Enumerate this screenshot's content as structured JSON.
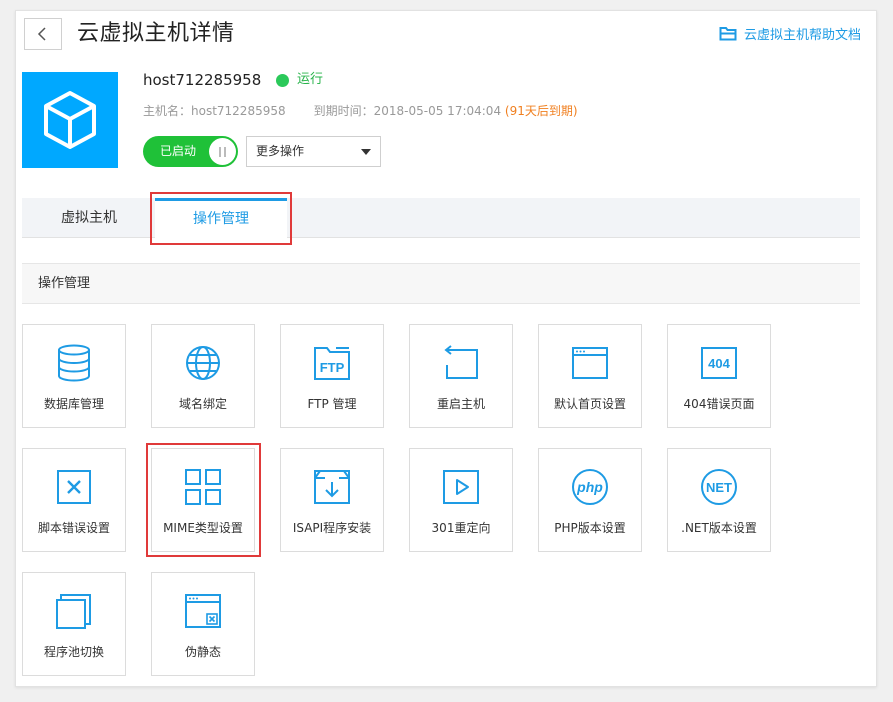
{
  "header": {
    "title": "云虚拟主机详情",
    "help_link": "云虚拟主机帮助文档"
  },
  "host": {
    "name": "host712285958",
    "status": "运行",
    "hostname_label": "主机名：host712285958",
    "expiry_label": "到期时间：2018-05-05 17:04:04",
    "expiry_note": "(91天后到期)",
    "toggle_label": "已启动",
    "more_actions": "更多操作"
  },
  "tabs": [
    {
      "label": "虚拟主机"
    },
    {
      "label": "操作管理"
    }
  ],
  "section": {
    "title": "操作管理"
  },
  "tiles": [
    {
      "label": "数据库管理",
      "icon": "database-icon"
    },
    {
      "label": "域名绑定",
      "icon": "globe-icon"
    },
    {
      "label": "FTP 管理",
      "icon": "ftp-folder-icon",
      "icon_text": "FTP"
    },
    {
      "label": "重启主机",
      "icon": "restart-icon"
    },
    {
      "label": "默认首页设置",
      "icon": "browser-window-icon"
    },
    {
      "label": "404错误页面",
      "icon": "error-404-icon",
      "icon_text": "404"
    },
    {
      "label": "脚本错误设置",
      "icon": "script-error-icon"
    },
    {
      "label": "MIME类型设置",
      "icon": "grid-icon"
    },
    {
      "label": "ISAPI程序安装",
      "icon": "install-box-icon"
    },
    {
      "label": "301重定向",
      "icon": "redirect-play-icon"
    },
    {
      "label": "PHP版本设置",
      "icon": "php-icon",
      "icon_text": "php"
    },
    {
      "label": ".NET版本设置",
      "icon": "dotnet-icon",
      "icon_text": "NET"
    },
    {
      "label": "程序池切换",
      "icon": "app-pool-icon"
    },
    {
      "label": "伪静态",
      "icon": "rewrite-window-icon"
    }
  ],
  "colors": {
    "accent": "#1e9be4",
    "running": "#2bc95a",
    "warning": "#f07f1f",
    "highlight": "#e03a3a"
  }
}
